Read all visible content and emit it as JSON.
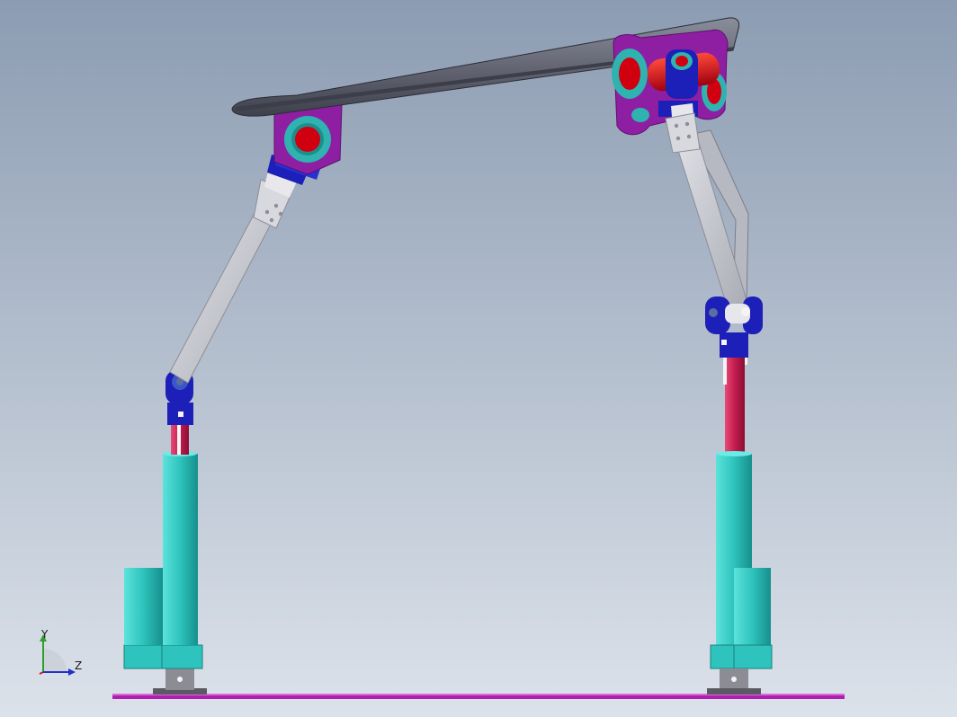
{
  "viewport": {
    "background_top": "#8C9CB2",
    "background_bottom": "#DCE2EA"
  },
  "triad": {
    "y_label": "Y",
    "z_label": "Z",
    "y_color": "#2F9E2F",
    "z_color": "#2030C8",
    "x_color": "#C82020"
  },
  "colors": {
    "platform": "#4A4C5A",
    "bracket": "#8E1FA3",
    "bearing": "#2FB3B0",
    "pin": "#D00010",
    "joint": "#1C1FB8",
    "link": "#C9CBD2",
    "rod": "#C21C4E",
    "cylinder": "#2EC3BD",
    "base": "#7A7A82",
    "ground": "#B01FB0"
  }
}
